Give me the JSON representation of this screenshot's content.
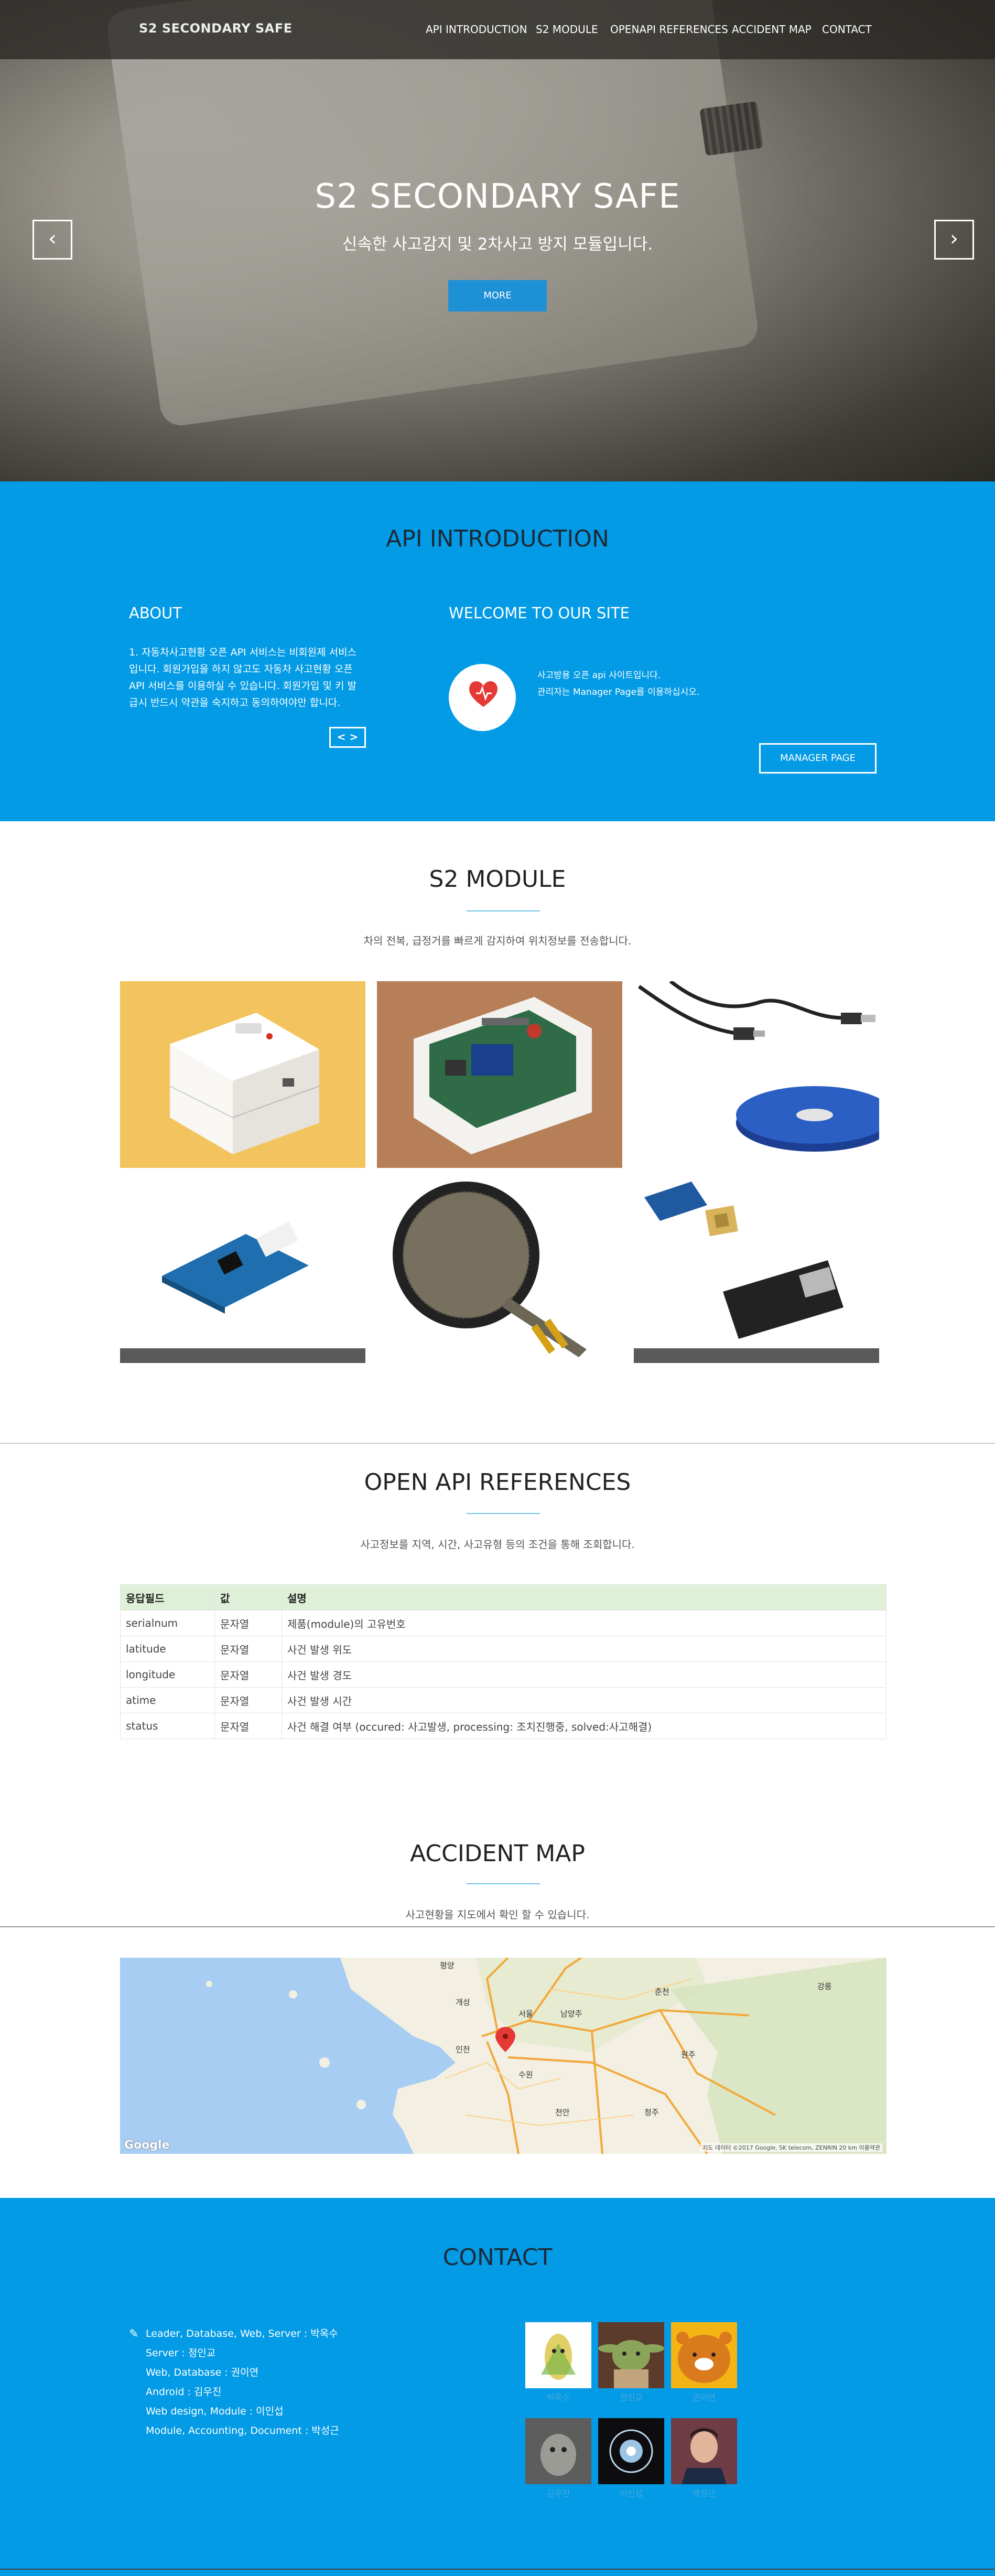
{
  "nav": {
    "brand": "S2 SECONDARY SAFE",
    "items": [
      "API INTRODUCTION",
      "S2 MODULE",
      "OPENAPI REFERENCES",
      "ACCIDENT MAP",
      "CONTACT"
    ]
  },
  "hero": {
    "title": "S2 SECONDARY SAFE",
    "subtitle": "신속한 사고감지 및 2차사고 방지 모듈입니다.",
    "more_label": "MORE",
    "prev_icon": "chevron-left-icon",
    "next_icon": "chevron-right-icon"
  },
  "api_intro": {
    "title": "API INTRODUCTION",
    "about_heading": "ABOUT",
    "about_text": "1. 자동차사고현황 오픈 API 서비스는 비회원제 서비스입니다. 회원가입을 하지 않고도 자동차 사고현황 오픈API 서비스를 이용하실 수 있습니다. 회원가입 및 키 발급시 반드시 약관을 숙지하고 동의하여야만 합니다.",
    "code_label": "< >",
    "welcome_heading": "WELCOME TO OUR SITE",
    "welcome_line1": "사고방용 오픈 api 사이트입니다.",
    "welcome_line2": "관리자는 Manager Page를 이용하십시오.",
    "manager_label": "MANAGER PAGE"
  },
  "module": {
    "title": "S2 MODULE",
    "subtitle": "차의 전복, 급정거를 빠르게 감지하여 위치정보를 전송합니다."
  },
  "openapi": {
    "title": "OPEN API REFERENCES",
    "subtitle": "사고정보를 지역, 시간, 사고유형 등의 조건을 통해 조회합니다.",
    "headers": [
      "응답필드",
      "값",
      "설명"
    ],
    "rows": [
      [
        "serialnum",
        "문자열",
        "제품(module)의 고유번호"
      ],
      [
        "latitude",
        "문자열",
        "사건 발생 위도"
      ],
      [
        "longitude",
        "문자열",
        "사건 발생 경도"
      ],
      [
        "atime",
        "문자열",
        "사건 발생 시간"
      ],
      [
        "status",
        "문자열",
        "사건 해결 여부 (occured: 사고발생, processing: 조치진행중, solved:사고해결)"
      ]
    ]
  },
  "map": {
    "title": "ACCIDENT MAP",
    "subtitle": "사고현황을 지도에서 확인 할 수 있습니다.",
    "google_label": "Google",
    "attribution": "지도 데이터 ©2017 Google, SK telecom, ZENRIN  20 km  이용약관",
    "city_labels": [
      "평양",
      "서울",
      "인천",
      "수원",
      "춘천",
      "강릉",
      "개성",
      "원주",
      "청주",
      "천안",
      "남양주"
    ]
  },
  "contact": {
    "title": "CONTACT",
    "pen_icon": "pencil-icon",
    "team": [
      "Leader, Database, Web, Server : 박옥수",
      "Server : 정인교",
      "Web, Database : 권이연",
      "Android : 김우진",
      "Web design, Module : 이인섭",
      "Module, Accounting, Document : 박성근"
    ],
    "avatar_names": [
      "박옥수",
      "정인교",
      "권이연",
      "김우진",
      "이인섭",
      "박성근"
    ]
  },
  "colors": {
    "brand_blue": "#039be5",
    "button_blue": "#1e90d6",
    "table_header": "#dff0d8",
    "divider": "#6ec1ea"
  }
}
